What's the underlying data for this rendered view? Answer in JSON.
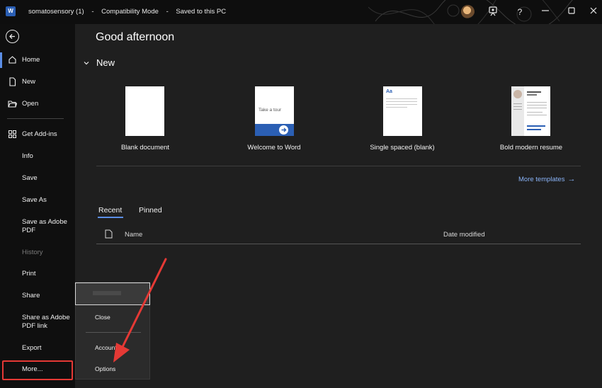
{
  "window": {
    "app_icon_letter": "W",
    "document_name": "somatosensory (1)",
    "mode": "Compatibility Mode",
    "save_status": "Saved to this PC",
    "help_glyph": "?"
  },
  "sidebar": {
    "items": [
      {
        "label": "Home"
      },
      {
        "label": "New"
      },
      {
        "label": "Open"
      },
      {
        "label": "Get Add-ins"
      },
      {
        "label": "Info"
      },
      {
        "label": "Save"
      },
      {
        "label": "Save As"
      },
      {
        "label": "Save as Adobe PDF"
      },
      {
        "label": "History"
      },
      {
        "label": "Print"
      },
      {
        "label": "Share"
      },
      {
        "label": "Share as Adobe PDF link"
      },
      {
        "label": "Export"
      },
      {
        "label": "More..."
      }
    ]
  },
  "main": {
    "greeting": "Good afternoon",
    "new_heading": "New",
    "templates": [
      {
        "label": "Blank document"
      },
      {
        "label": "Welcome to Word",
        "thumb_text": "Take a tour"
      },
      {
        "label": "Single spaced (blank)",
        "thumb_text": "Aa"
      },
      {
        "label": "Bold modern resume"
      }
    ],
    "more_templates": "More templates",
    "tabs": [
      {
        "label": "Recent"
      },
      {
        "label": "Pinned"
      }
    ],
    "columns": {
      "name": "Name",
      "date_modified": "Date modified"
    }
  },
  "popup_menu": {
    "items": [
      {
        "label": "Close"
      },
      {
        "label": "Account"
      },
      {
        "label": "Options"
      }
    ]
  },
  "colors": {
    "accent": "#5b8ee6",
    "link": "#8ab4f8",
    "annotation": "#e53935"
  }
}
